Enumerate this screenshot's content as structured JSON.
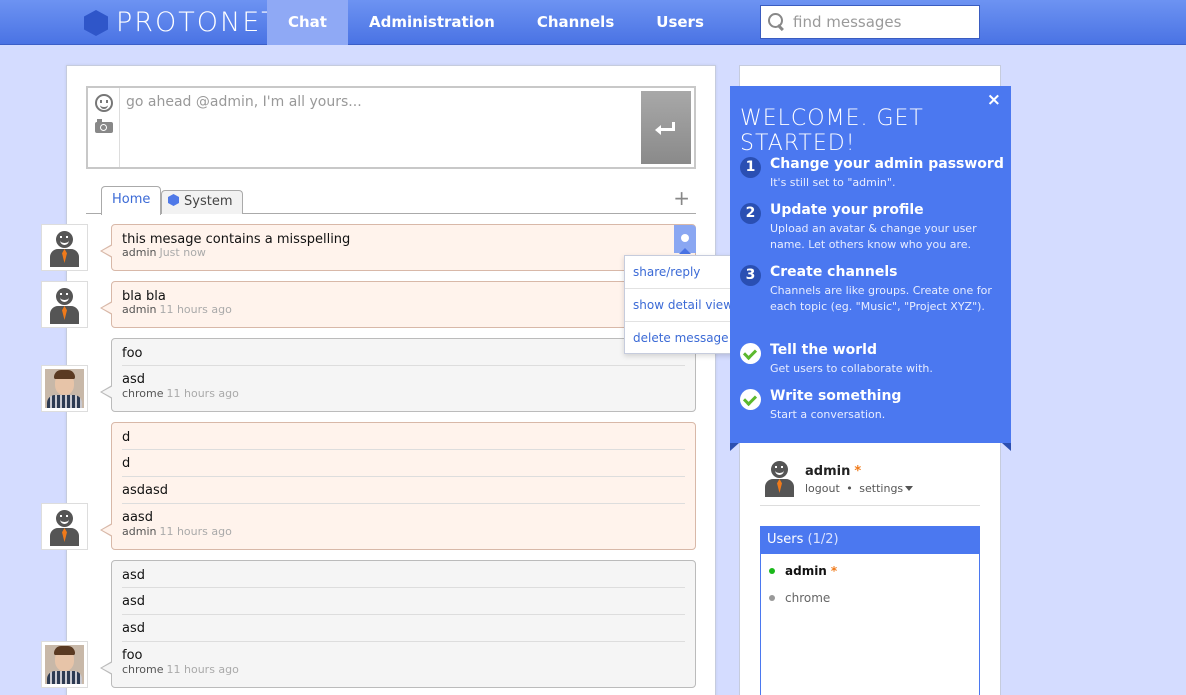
{
  "app": {
    "logo_text": "PROTONET",
    "logo_reg": "®"
  },
  "nav": {
    "items": [
      {
        "label": "Chat",
        "active": true
      },
      {
        "label": "Administration",
        "active": false
      },
      {
        "label": "Channels",
        "active": false
      },
      {
        "label": "Users",
        "active": false
      }
    ]
  },
  "search": {
    "placeholder": "find messages",
    "value": ""
  },
  "composer": {
    "placeholder": "go ahead @admin, I'm all yours...",
    "value": ""
  },
  "tabs": {
    "home": "Home",
    "system": "System",
    "add": "+"
  },
  "messages": [
    {
      "author": "admin",
      "time": "Just now",
      "lines": [
        "this mesage contains a misspelling"
      ],
      "own": true
    },
    {
      "author": "admin",
      "time": "11 hours ago",
      "lines": [
        "bla bla"
      ],
      "own": true
    },
    {
      "author": "chrome",
      "time": "11 hours ago",
      "lines": [
        "foo",
        "asd"
      ],
      "own": false
    },
    {
      "author": "admin",
      "time": "11 hours ago",
      "lines": [
        "d",
        "d",
        "asdasd",
        "aasd"
      ],
      "own": true
    },
    {
      "author": "chrome",
      "time": "11 hours ago",
      "lines": [
        "asd",
        "asd",
        "asd",
        "foo"
      ],
      "own": false
    }
  ],
  "context_menu": {
    "share": "share/reply",
    "detail": "show detail view",
    "delete": "delete message"
  },
  "welcome": {
    "title": "WELCOME. GET STARTED!",
    "close": "×",
    "steps": [
      {
        "num": "1",
        "title": "Change your admin password",
        "desc": "It's still set to \"admin\".",
        "done": false
      },
      {
        "num": "2",
        "title": "Update your profile",
        "desc": "Upload an avatar & change your user name. Let others know who you are.",
        "done": false
      },
      {
        "num": "3",
        "title": "Create channels",
        "desc": "Channels are like groups. Create one for each topic (eg. \"Music\", \"Project XYZ\").",
        "done": false
      },
      {
        "num": "",
        "title": "Tell the world",
        "desc": "Get users to collaborate with.",
        "done": true
      },
      {
        "num": "",
        "title": "Write something",
        "desc": "Start a conversation.",
        "done": true
      }
    ]
  },
  "me": {
    "name": "admin",
    "star": "*",
    "logout": "logout",
    "sep": "•",
    "settings": "settings"
  },
  "users": {
    "title": "Users",
    "count": "(1/2)",
    "list": [
      {
        "name": "admin",
        "star": "*",
        "online": true
      },
      {
        "name": "chrome",
        "star": "",
        "online": false
      }
    ]
  },
  "colors": {
    "accent": "#4b78f0",
    "topbar": "#5a82ec",
    "background": "#d4dcff",
    "online": "#1ab81a",
    "star": "#f07a1a"
  }
}
